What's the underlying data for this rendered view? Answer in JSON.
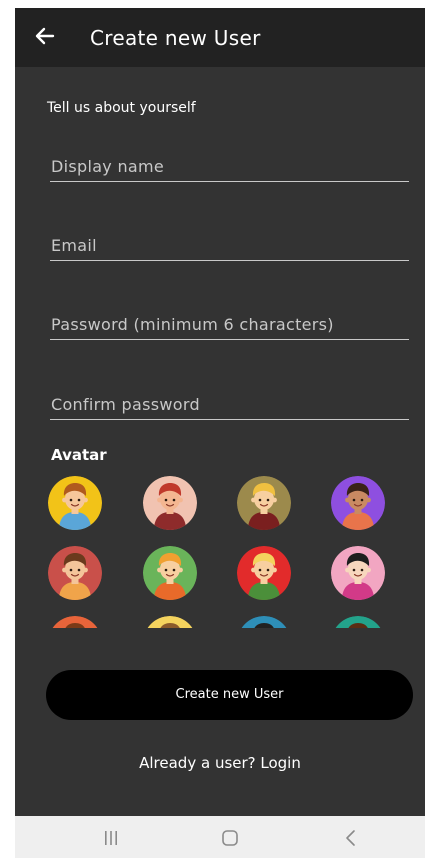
{
  "appbar": {
    "title": "Create new User",
    "back_icon": "arrow-left-icon"
  },
  "form": {
    "intro": "Tell us about yourself",
    "fields": [
      {
        "label": "Display name"
      },
      {
        "label": "Email"
      },
      {
        "label": "Password (minimum 6 characters)"
      },
      {
        "label": "Confirm password"
      }
    ]
  },
  "avatars": {
    "label": "Avatar",
    "items": [
      {
        "name": "avatar-1",
        "bg": "#f2c318",
        "skin": "#f6c79b",
        "hair": "#b05a1e",
        "shirt": "#5aa6d8"
      },
      {
        "name": "avatar-2",
        "bg": "#f1c3b1",
        "skin": "#f4b691",
        "hair": "#c0392b",
        "shirt": "#8e2b2b"
      },
      {
        "name": "avatar-3",
        "bg": "#9c8a4c",
        "skin": "#f7cfa0",
        "hair": "#f0c040",
        "shirt": "#7a1f1f"
      },
      {
        "name": "avatar-4",
        "bg": "#8e4fe0",
        "skin": "#c98a62",
        "hair": "#3a2318",
        "shirt": "#e8744b"
      },
      {
        "name": "avatar-5",
        "bg": "#c9504a",
        "skin": "#f4c59a",
        "hair": "#6b3a1d",
        "shirt": "#f0a44a"
      },
      {
        "name": "avatar-6",
        "bg": "#6ab45a",
        "skin": "#f7cfa0",
        "hair": "#f0a030",
        "shirt": "#e86a2a"
      },
      {
        "name": "avatar-7",
        "bg": "#e22b2b",
        "skin": "#f7cfa0",
        "hair": "#f4d35e",
        "shirt": "#4b8f3a"
      },
      {
        "name": "avatar-8",
        "bg": "#f2a6c2",
        "skin": "#f7d7bd",
        "hair": "#1e1e1e",
        "shirt": "#d23a88"
      },
      {
        "name": "avatar-9",
        "bg": "#e8643a",
        "skin": "#f4c59a",
        "hair": "#7a3a18",
        "shirt": "#3a7ab0"
      },
      {
        "name": "avatar-10",
        "bg": "#f4d35e",
        "skin": "#f7cfa0",
        "hair": "#8a5a2b",
        "shirt": "#c0392b"
      },
      {
        "name": "avatar-11",
        "bg": "#2e8fb8",
        "skin": "#c98a62",
        "hair": "#222222",
        "shirt": "#f2c318"
      },
      {
        "name": "avatar-12",
        "bg": "#23a38b",
        "skin": "#f4c59a",
        "hair": "#5a2d14",
        "shirt": "#8e4fe0"
      }
    ]
  },
  "actions": {
    "create_label": "Create new User",
    "login_link": "Already a user? Login"
  },
  "navbar": {
    "recent_icon": "recent-apps-icon",
    "home_icon": "home-icon",
    "back_icon": "nav-back-icon"
  },
  "colors": {
    "background": "#333333",
    "appbar": "#222222",
    "button": "#000000",
    "navbar": "#efefef"
  }
}
